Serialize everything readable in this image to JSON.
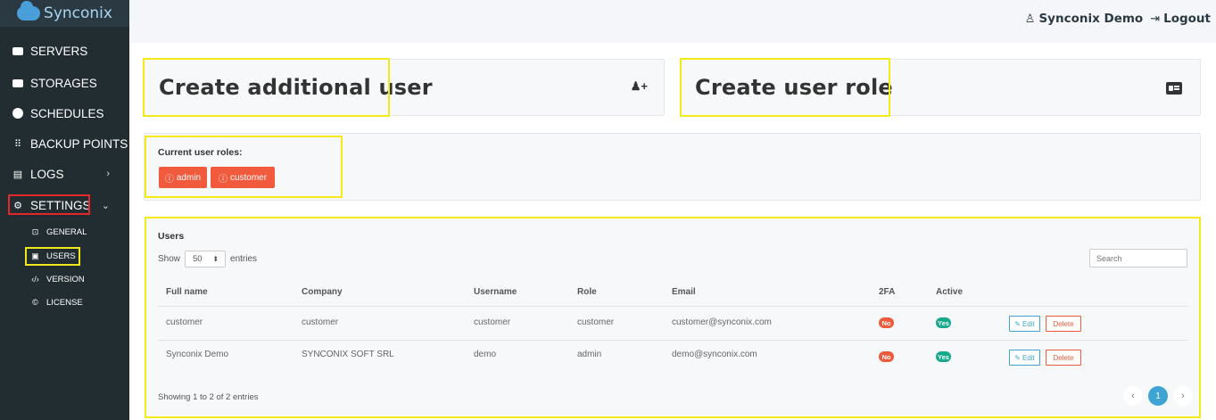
{
  "brand": {
    "name": "Synconix"
  },
  "sidebar": {
    "items": [
      {
        "label": "SERVERS",
        "icon": "server-icon"
      },
      {
        "label": "STORAGES",
        "icon": "storage-icon"
      },
      {
        "label": "SCHEDULES",
        "icon": "clock-icon"
      },
      {
        "label": "BACKUP POINTS",
        "icon": "grid-icon"
      },
      {
        "label": "LOGS",
        "icon": "log-icon",
        "chevron": "›"
      },
      {
        "label": "SETTINGS",
        "icon": "gear-icon",
        "chevron": "⌄"
      }
    ],
    "subitems": [
      {
        "label": "GENERAL",
        "icon": "chip-icon"
      },
      {
        "label": "USERS",
        "icon": "user-card-icon"
      },
      {
        "label": "VERSION",
        "icon": "code-icon"
      },
      {
        "label": "LICENSE",
        "icon": "license-icon"
      }
    ]
  },
  "topbar": {
    "user": "Synconix Demo",
    "logout": "Logout"
  },
  "cards": {
    "create_user": "Create additional user",
    "create_role": "Create user role"
  },
  "roles": {
    "label": "Current user roles:",
    "items": [
      "admin",
      "customer"
    ]
  },
  "users": {
    "title": "Users",
    "show_prefix": "Show",
    "page_size": "50",
    "show_suffix": "entries",
    "search_placeholder": "Search",
    "columns": [
      "Full name",
      "Company",
      "Username",
      "Role",
      "Email",
      "2FA",
      "Active"
    ],
    "rows": [
      {
        "full_name": "customer",
        "company": "customer",
        "username": "customer",
        "role": "customer",
        "email": "customer@synconix.com",
        "twofa": "No",
        "active": "Yes"
      },
      {
        "full_name": "Synconix Demo",
        "company": "SYNCONIX SOFT SRL",
        "username": "demo",
        "role": "admin",
        "email": "demo@synconix.com",
        "twofa": "No",
        "active": "Yes"
      }
    ],
    "edit_label": "Edit",
    "delete_label": "Delete",
    "footer": "Showing 1 to 2 of 2 entries",
    "page": "1",
    "prev": "‹",
    "next": "›"
  },
  "colors": {
    "sidebar": "#222d32",
    "accent": "#3fa4d2",
    "danger": "#ee5a3c",
    "success": "#17a98b",
    "highlight": "#f3ea17"
  }
}
